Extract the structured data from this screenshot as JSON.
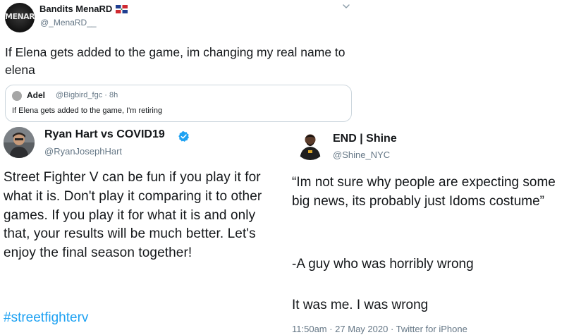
{
  "tweet_top": {
    "display_name": "Bandits MenaRD",
    "handle": "@_MenaRD__",
    "avatar_text": "MENARD",
    "flag_icon": "dominican-republic-flag-icon",
    "menu_icon": "chevron-down-icon",
    "text": "If Elena gets added to the game, im changing my real name to elena",
    "quote": {
      "display_name": "Adel",
      "handle": "@Bigbird_fgc · 8h",
      "text": "If Elena gets added to the game, I'm retiring"
    }
  },
  "tweet_left": {
    "display_name": "Ryan Hart vs COVID19",
    "handle": "@RyanJosephHart",
    "verified_icon": "verified-badge-icon",
    "text": "Street Fighter V can be fun if you play it for what it is. Don't play it comparing it to other games. If you play it for what it is and only that, your results will be much better. Let's enjoy the final season together!",
    "hashtag": "#streetfighterv"
  },
  "tweet_right": {
    "display_name": "END | Shine",
    "handle": "@Shine_NYC",
    "text_part1": "“Im not sure why people are expecting some big news, its probably just Idoms costume”",
    "text_part2": "-A guy who was horribly wrong",
    "text_part3": "It was me. I was wrong",
    "meta": "11:50am · 27 May 2020 · Twitter for iPhone"
  },
  "colors": {
    "text": "#14171a",
    "secondary": "#657786",
    "link": "#1da1f2",
    "border": "#ccd6dd"
  }
}
